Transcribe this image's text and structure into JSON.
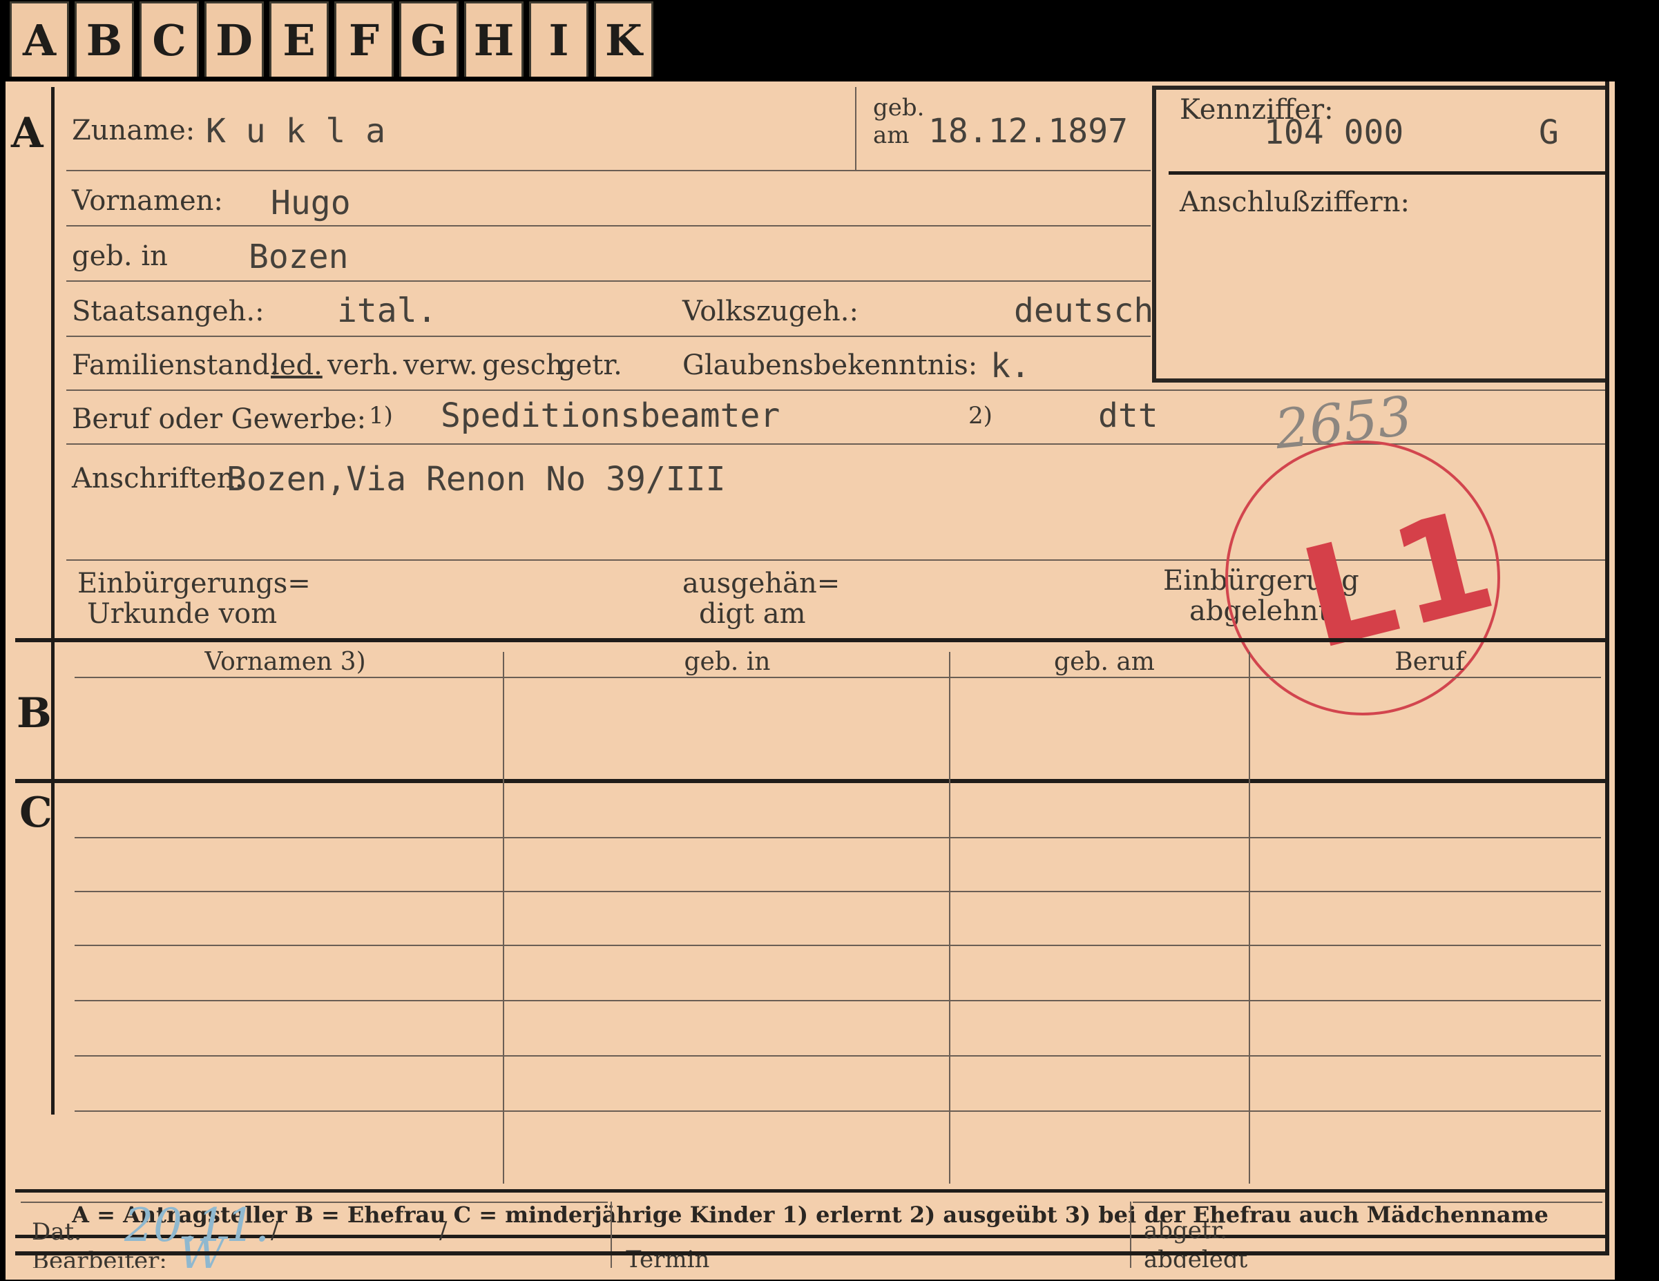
{
  "tabs": [
    "A",
    "B",
    "C",
    "D",
    "E",
    "F",
    "G",
    "H",
    "I",
    "K"
  ],
  "section_a": {
    "letter": "A",
    "zuname_label": "Zuname:",
    "zuname_value": "K u k l a",
    "geb_label_1": "geb.",
    "geb_label_2": "am",
    "geb_am_value": "18.12.1897",
    "kennziffer_label": "Kennziffer:",
    "kennziffer_value": "104 000",
    "kennziffer_suffix": "G",
    "anschluss_label": "Anschlußziffern:",
    "vornamen_label": "Vornamen:",
    "vornamen_value": "Hugo",
    "geb_in_label": "geb. in",
    "geb_in_value": "Bozen",
    "staatsangeh_label": "Staatsangeh.:",
    "staatsangeh_value": "ital.",
    "volkszugeh_label": "Volkszugeh.:",
    "volkszugeh_value": "deutsch",
    "familienstand_label": "Familienstand:",
    "familienstand_options": [
      "led.",
      "verh.",
      "verw.",
      "gesch.",
      "getr."
    ],
    "familienstand_selected": "led.",
    "glaubens_label": "Glaubensbekenntnis:",
    "glaubens_value": "k.",
    "beruf_label": "Beruf oder Gewerbe:",
    "beruf_note1": "1)",
    "beruf_value1": "Speditionsbeamter",
    "beruf_note2": "2)",
    "beruf_value2": "dtt",
    "anschriften_label": "Anschriften:",
    "anschriften_value": "Bozen,Via Renon No 39/III",
    "einbuergerungs_label_1": "Einbürgerungs=",
    "einbuergerungs_label_2": "Urkunde vom",
    "ausgehaen_label_1": "ausgehän=",
    "ausgehaen_label_2": "digt am",
    "abgelehnt_label_1": "Einbürgerung",
    "abgelehnt_label_2": "abgelehnt"
  },
  "stamp": {
    "text": "L1",
    "pencil_number": "2653",
    "color": "#d54049"
  },
  "section_b": {
    "letter": "B",
    "columns": [
      "Vornamen 3)",
      "geb. in",
      "geb. am",
      "Beruf"
    ]
  },
  "section_c": {
    "letter": "C"
  },
  "legend": {
    "text": "A = Antragsteller   B = Ehefrau   C = minderjährige Kinder   1) erlernt   2) ausgeübt   3) bei der Ehefrau auch Mädchenname"
  },
  "footer": {
    "bearbeiter_label": "Bearbeiter:",
    "bearbeiter_initial": "W",
    "dat_label": "Dat.",
    "dat_value": "20.11.",
    "dat_sep1": "/",
    "dat_sep2": "/",
    "termin_label": "Termin",
    "abgelegt_label": "abgelegt",
    "abgetr_label": "abgetr."
  },
  "colors": {
    "card": "#f3cfad",
    "background": "#000000",
    "ink": "#1f1c19"
  }
}
